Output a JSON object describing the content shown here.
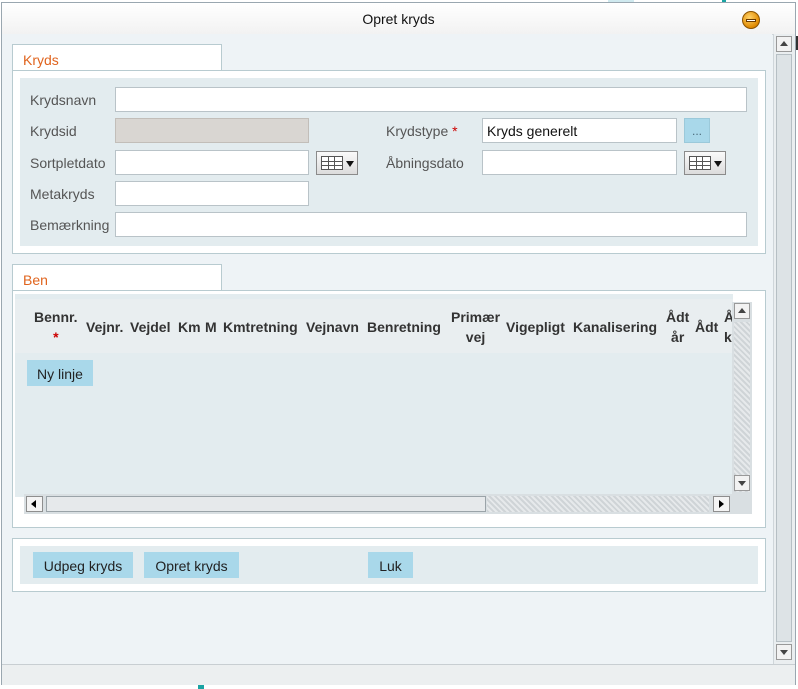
{
  "window": {
    "title": "Opret kryds"
  },
  "kryds": {
    "tab_label": "Kryds",
    "fields": {
      "krydsnavn": {
        "label": "Krydsnavn",
        "value": ""
      },
      "krydsid": {
        "label": "Krydsid",
        "value": ""
      },
      "krydstype": {
        "label": "Krydstype",
        "required_mark": "*",
        "value": "Kryds generelt",
        "picker_label": "..."
      },
      "sortpletdato": {
        "label": "Sortpletdato",
        "value": ""
      },
      "aabningsdato": {
        "label": "Åbningsdato",
        "value": ""
      },
      "metakryds": {
        "label": "Metakryds",
        "value": ""
      },
      "bemaerkning": {
        "label": "Bemærkning",
        "value": ""
      }
    }
  },
  "ben": {
    "tab_label": "Ben",
    "columns": {
      "bennr": {
        "line1": "Bennr.",
        "required_mark": "*"
      },
      "vejnr": "Vejnr.",
      "vejdel": "Vejdel",
      "km": "Km",
      "m": "M",
      "kmtretning": "Kmtretning",
      "vejnavn": "Vejnavn",
      "benretning": "Benretning",
      "primaer_vej": {
        "line1": "Primær",
        "line2": "vej"
      },
      "vigepligt": "Vigepligt",
      "kanalisering": "Kanalisering",
      "adt_aar": {
        "line1": "Ådt",
        "line2": "år"
      },
      "adt": "Ådt",
      "partial": {
        "line1": "Å",
        "line2": "k"
      }
    },
    "rows": [],
    "new_line_button": "Ny linje"
  },
  "actions": {
    "udpeg": "Udpeg kryds",
    "opret": "Opret kryds",
    "luk": "Luk"
  },
  "colors": {
    "tab_text": "#e0641e",
    "button_bg": "#a9d8ea",
    "panel_bg": "#e3ecef",
    "required": "#cc0000"
  }
}
